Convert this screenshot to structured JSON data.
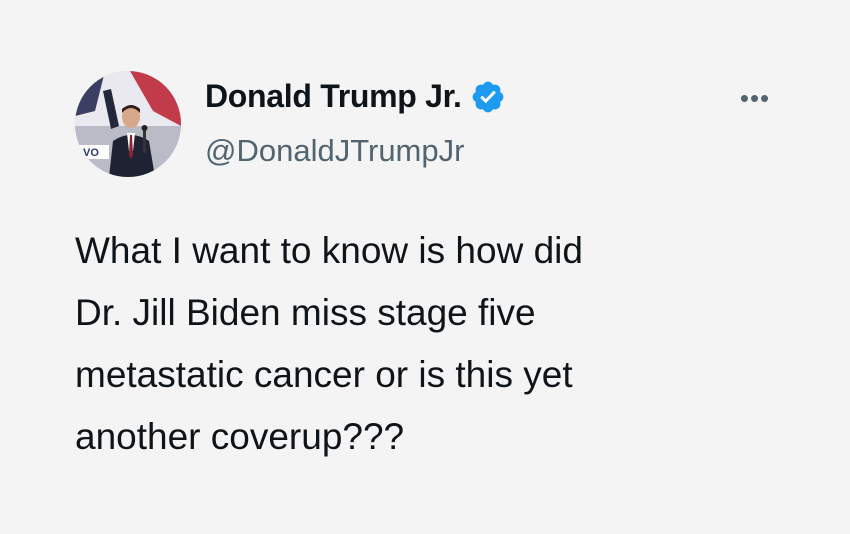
{
  "tweet": {
    "author": {
      "display_name": "Donald Trump Jr.",
      "handle": "@DonaldJTrumpJr",
      "verified": true,
      "avatar_icon": "profile-photo",
      "verified_icon": "verified-badge-icon"
    },
    "more_icon": "more-options-icon",
    "more_label": "•••",
    "text": "What I want to know is how did\nDr. Jill Biden miss stage five\nmetastatic cancer or is this yet\nanother coverup???"
  },
  "colors": {
    "background": "#f4f4f4",
    "primary_text": "#0f1419",
    "secondary_text": "#536471",
    "verified_blue": "#1d9bf0"
  }
}
